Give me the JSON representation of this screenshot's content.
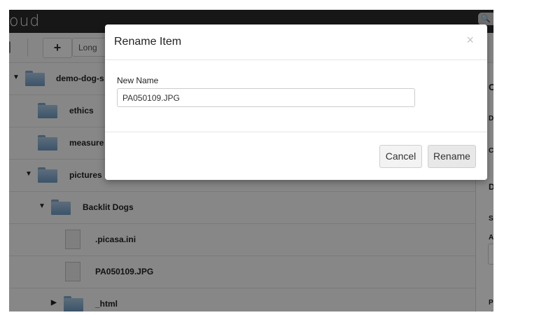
{
  "app": {
    "logo_text": "oud",
    "search_icon": "search-icon"
  },
  "toolbar": {
    "add_label": "+",
    "view_label": "Long"
  },
  "tree": {
    "rows": [
      {
        "label": "demo-dog-s",
        "type": "folder",
        "expanded": true
      },
      {
        "label": "ethics",
        "type": "folder"
      },
      {
        "label": "measure",
        "type": "folder"
      },
      {
        "label": "pictures",
        "type": "folder",
        "expanded": true
      },
      {
        "label": "Backlit Dogs",
        "type": "folder",
        "expanded": true
      },
      {
        "label": ".picasa.ini",
        "type": "file"
      },
      {
        "label": "PA050109.JPG",
        "type": "file"
      },
      {
        "label": "_html",
        "type": "folder",
        "expanded": false
      }
    ]
  },
  "panel": {
    "letters": [
      "C",
      "D",
      "C",
      "D",
      "S",
      "A",
      "P",
      "d"
    ]
  },
  "modal": {
    "title": "Rename Item",
    "close_glyph": "×",
    "field_label": "New Name",
    "field_value": "PA050109.JPG",
    "cancel_label": "Cancel",
    "rename_label": "Rename"
  }
}
